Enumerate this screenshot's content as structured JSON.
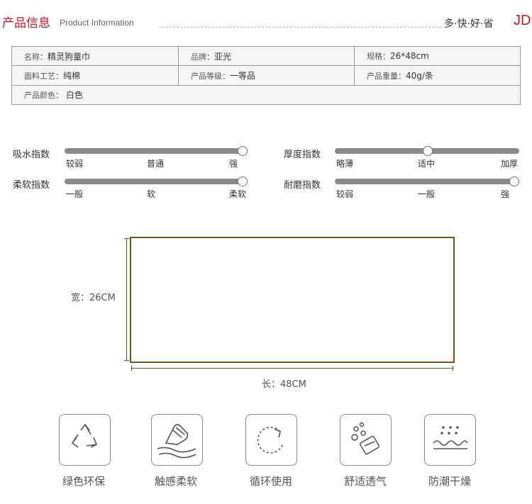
{
  "header": {
    "title": "产品信息",
    "subtitle": "Product Information",
    "slogan": "多·快·好·省",
    "brand": "JD"
  },
  "info": {
    "name_label": "名称：",
    "name_value": "精灵狗童巾",
    "brand_label": "品牌：",
    "brand_value": "亚光",
    "spec_label": "规格：",
    "spec_value": "26*48cm",
    "material_label": "面料工艺：",
    "material_value": "纯棉",
    "grade_label": "产品等级：",
    "grade_value": "一等品",
    "weight_label": "产品重量：",
    "weight_value": "40g/条",
    "color_label": "产品颜色：",
    "color_value": "白色"
  },
  "ratings": [
    {
      "label": "吸水指数",
      "ticks": [
        "较弱",
        "普通",
        "强"
      ],
      "level": 1.0
    },
    {
      "label": "柔软指数",
      "ticks": [
        "一般",
        "软",
        "柔软"
      ],
      "level": 1.0
    },
    {
      "label": "厚度指数",
      "ticks": [
        "略薄",
        "适中",
        "加厚"
      ],
      "level": 0.5
    },
    {
      "label": "耐磨指数",
      "ticks": [
        "较弱",
        "一般",
        "强"
      ],
      "level": 1.0
    }
  ],
  "dimensions": {
    "width": "宽：26CM",
    "length": "长：48CM"
  },
  "features": [
    {
      "label": "绿色环保",
      "icon": "recycle-icon"
    },
    {
      "label": "触感柔软",
      "icon": "soft-touch-icon"
    },
    {
      "label": "循环使用",
      "icon": "cycle-icon"
    },
    {
      "label": "舒适透气",
      "icon": "breathable-icon"
    },
    {
      "label": "防潮干燥",
      "icon": "moisture-proof-icon"
    }
  ],
  "colors": {
    "accent": "#c81623",
    "track": "#8a8a8a",
    "frame": "#6a5a26"
  }
}
